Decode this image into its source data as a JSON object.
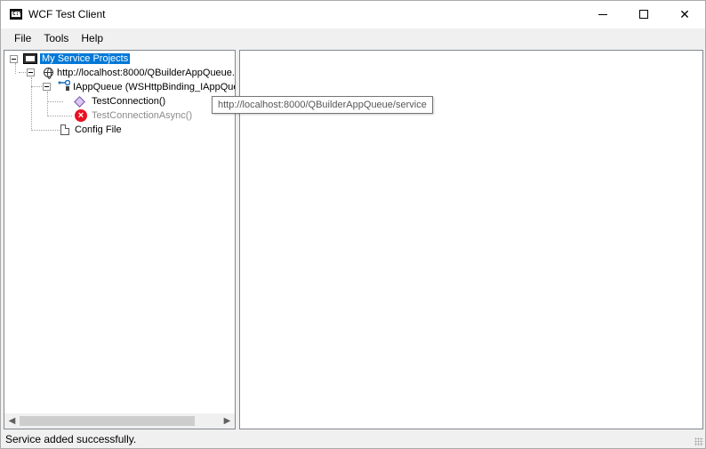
{
  "window": {
    "title": "WCF Test Client",
    "controls": {
      "minimize": "minimize",
      "maximize": "maximize",
      "close": "✕"
    }
  },
  "menu": [
    {
      "label": "File"
    },
    {
      "label": "Tools"
    },
    {
      "label": "Help"
    }
  ],
  "tree": {
    "root": {
      "label": "My Service Projects",
      "icon": "project-icon"
    },
    "endpoint": {
      "label": "http://localhost:8000/QBuilderAppQueue.",
      "icon": "globe-icon"
    },
    "contract": {
      "label": "IAppQueue (WSHttpBinding_IAppQue",
      "icon": "contract-icon"
    },
    "methods": [
      {
        "label": "TestConnection()",
        "icon": "method-icon",
        "enabled": true
      },
      {
        "label": "TestConnectionAsync()",
        "icon": "error-icon",
        "enabled": false
      }
    ],
    "config": {
      "label": "Config File",
      "icon": "file-icon"
    }
  },
  "tooltip": {
    "text": "http://localhost:8000/QBuilderAppQueue/service"
  },
  "status": {
    "text": "Service added successfully."
  },
  "colors": {
    "selection": "#0078d7",
    "error": "#e81123",
    "panel_border": "#828790"
  }
}
